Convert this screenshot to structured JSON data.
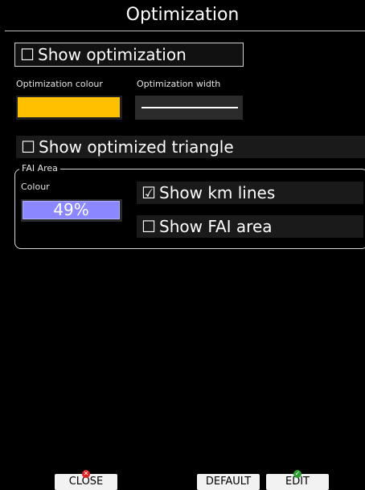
{
  "title": "Optimization",
  "show_optimization": {
    "label": "Show optimization",
    "checked": false
  },
  "optimization_colour": {
    "label": "Optimization colour",
    "color": "#ffc000"
  },
  "optimization_width": {
    "label": "Optimization width"
  },
  "show_optimized_triangle": {
    "label": "Show optimized triangle",
    "checked": false
  },
  "fai_area": {
    "legend": "FAI Area",
    "colour_label": "Colour",
    "colour_value": "49%",
    "colour_color": "#8a87ff",
    "show_km_lines": {
      "label": "Show km lines",
      "checked": true
    },
    "show_fai_area": {
      "label": "Show FAI area",
      "checked": false
    }
  },
  "footer": {
    "close_label": "CLOSE",
    "default_label": "DEFAULT",
    "edit_label": "EDIT",
    "close_icon": "close-icon",
    "edit_icon": "checkmark-icon"
  },
  "glyphs": {
    "unchecked": "☐",
    "checked": "☑"
  }
}
